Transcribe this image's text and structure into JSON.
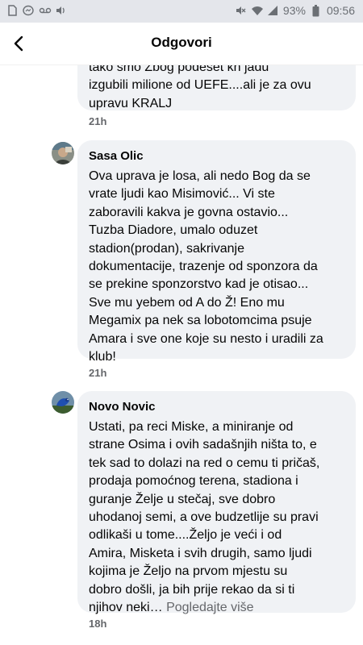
{
  "status_bar": {
    "battery": "93%",
    "time": "09:56",
    "icons": [
      "sim-icon",
      "messenger-icon",
      "voicemail-icon",
      "volume-icon",
      "mute-icon",
      "wifi-icon",
      "signal-icon",
      "battery-icon"
    ]
  },
  "header": {
    "title": "Odgovori",
    "back_icon": "back-arrow-icon"
  },
  "comments": [
    {
      "author": "",
      "text_lines": [
        "tako smo Zbog podeset kn jadu",
        "izgubili milione od UEFE....ali je za ovu",
        "upravu KRALJ"
      ],
      "time": "21h"
    },
    {
      "author": "Sasa Olic",
      "text_lines": [
        "Ova uprava je losa, ali nedo Bog da se",
        "vrate ljudi kao Misimović... Vi ste",
        "zaboravili kakva je govna ostavio...",
        "Tuzba Diadore, umalo oduzet",
        "stadion(prodan), sakrivanje",
        "dokumentacije, trazenje od sponzora da",
        "se prekine sponzorstvo kad je otisao...",
        "Sve mu yebem od A do Ž! Eno mu",
        "Megamix pa nek sa lobotomcima psuje",
        "Amara i sve one koje su nesto i uradili za",
        "klub!"
      ],
      "time": "21h"
    },
    {
      "author": "Novo Novic",
      "text_lines": [
        "Ustati, pa reci Miske, a miniranje od",
        "strane Osima i ovih sadašnjih ništa to, e",
        "tek sad to dolazi na red o cemu ti pričaš,",
        "prodaja pomoćnog terena, stadiona i",
        "guranje Želje u stečaj, sve dobro",
        "uhodanoj semi, a ove budzetlije su pravi",
        "odlikaši u tome....Željo je veći i od",
        "Amira, Misketa i svih drugih, samo ljudi",
        "kojima je Željo na prvom mjestu su",
        "dobro došli, ja bih prije rekao da si ti",
        "njihov neki…"
      ],
      "see_more": "Pogledajte više",
      "time": "18h"
    }
  ]
}
